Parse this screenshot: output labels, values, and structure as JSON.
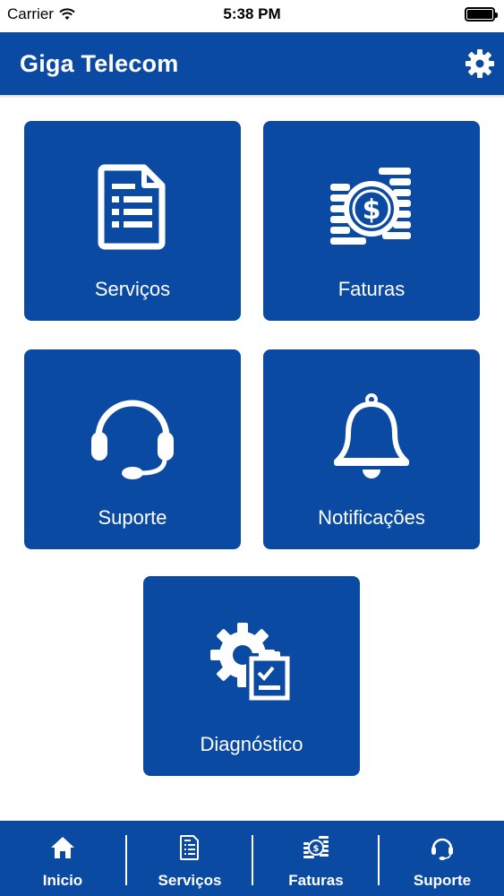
{
  "status_bar": {
    "carrier": "Carrier",
    "time": "5:38 PM"
  },
  "header": {
    "title": "Giga Telecom",
    "settings_icon": "gear-icon"
  },
  "tiles": [
    {
      "label": "Serviços",
      "icon": "document-list-icon"
    },
    {
      "label": "Faturas",
      "icon": "coins-dollar-icon"
    },
    {
      "label": "Suporte",
      "icon": "headset-icon"
    },
    {
      "label": "Notificações",
      "icon": "bell-icon"
    },
    {
      "label": "Diagnóstico",
      "icon": "gear-checklist-icon"
    }
  ],
  "tabbar": [
    {
      "label": "Inicio",
      "icon": "home-icon"
    },
    {
      "label": "Serviços",
      "icon": "document-list-icon"
    },
    {
      "label": "Faturas",
      "icon": "coins-dollar-icon"
    },
    {
      "label": "Suporte",
      "icon": "headset-icon"
    }
  ],
  "colors": {
    "brand_blue": "#0b4aa2",
    "background": "#ffffff",
    "text_on_brand": "#ffffff"
  }
}
